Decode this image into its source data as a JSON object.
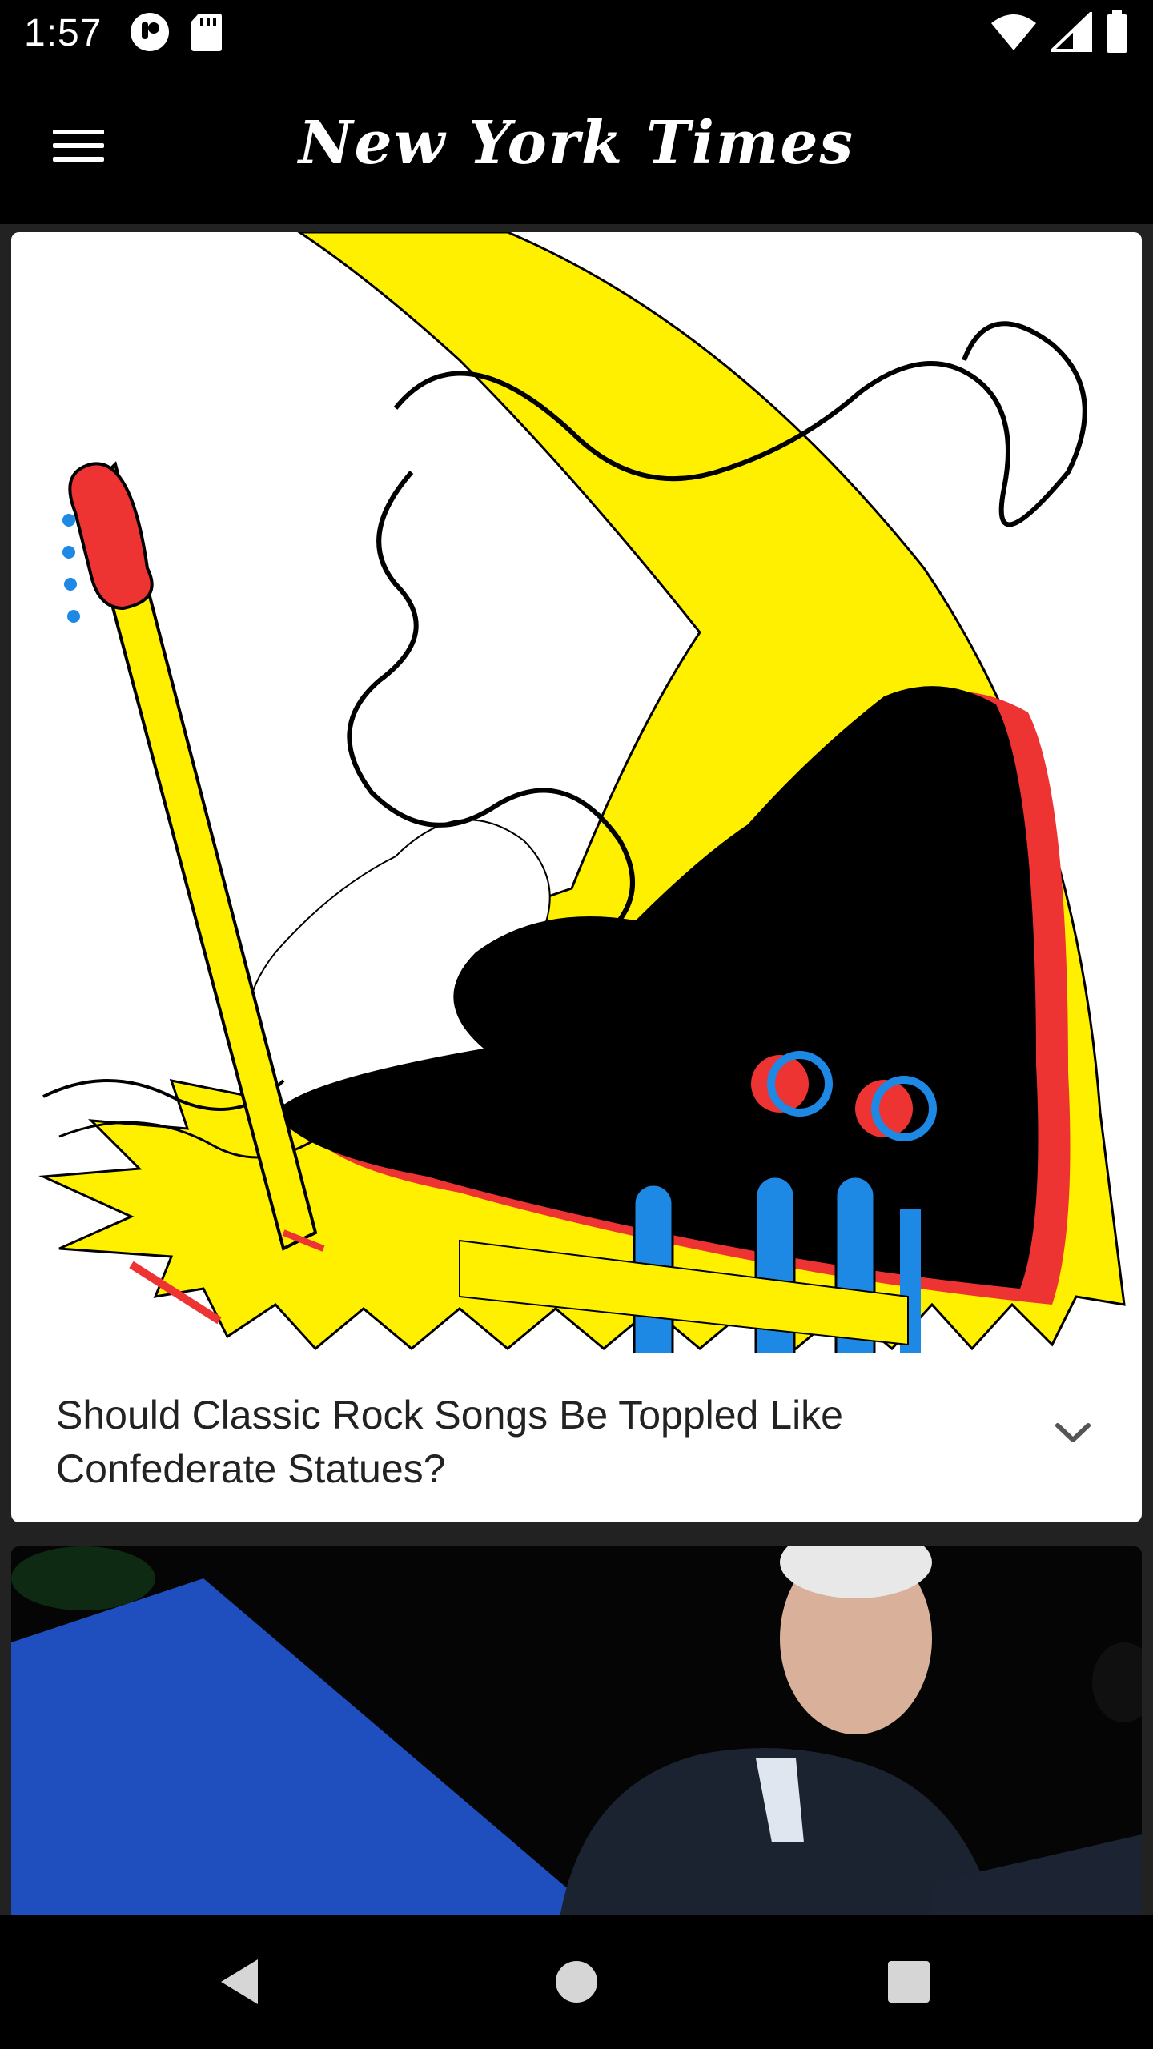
{
  "status_bar": {
    "time": "1:57",
    "left_icons": [
      "notification-icon",
      "sd-card-icon"
    ],
    "right_icons": [
      "wifi-icon",
      "cell-signal-icon",
      "battery-icon"
    ]
  },
  "app_bar": {
    "logo": "New York Times",
    "menu_icon": "hamburger-menu-icon"
  },
  "feed": {
    "articles": [
      {
        "headline": "Should Classic Rock Songs Be Toppled Like Confederate Statues?",
        "image": "illustration of a smashed electric guitar",
        "action_icon": "chevron-down-icon"
      },
      {
        "image": "photo of a man at a podium at night"
      }
    ]
  },
  "nav_bar": {
    "buttons": [
      "back-icon",
      "home-icon",
      "recents-icon"
    ]
  },
  "colors": {
    "background": "#000000",
    "card": "#ffffff",
    "headline_text": "#222222",
    "art_yellow": "#ffee00",
    "art_red": "#ee3333",
    "art_blue": "#1e88e5"
  }
}
